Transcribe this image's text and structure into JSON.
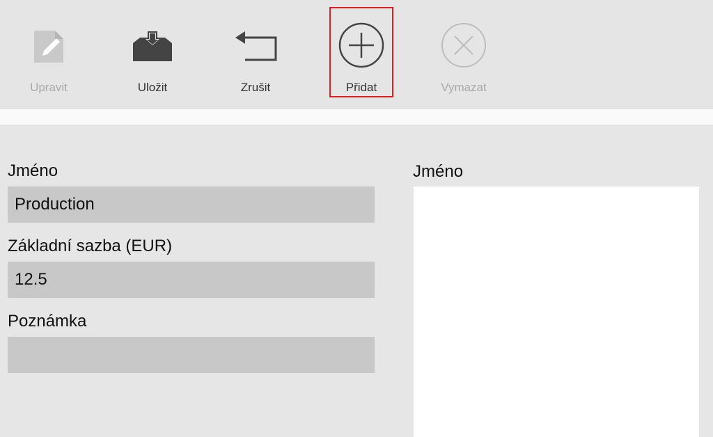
{
  "toolbar": {
    "buttons": [
      {
        "label": "Upravit",
        "icon": "edit-icon",
        "enabled": false
      },
      {
        "label": "Uložit",
        "icon": "save-icon",
        "enabled": true
      },
      {
        "label": "Zrušit",
        "icon": "undo-icon",
        "enabled": true
      },
      {
        "label": "Přidat",
        "icon": "add-icon",
        "enabled": true,
        "highlighted": true
      },
      {
        "label": "Vymazat",
        "icon": "delete-icon",
        "enabled": false
      }
    ]
  },
  "form": {
    "name_label": "Jméno",
    "name_value": "Production",
    "rate_label": "Základní sazba (EUR)",
    "rate_value": "12.5",
    "note_label": "Poznámka",
    "note_value": ""
  },
  "list": {
    "header": "Jméno"
  },
  "colors": {
    "highlight_border": "#e02020",
    "input_bg": "#c8c8c8",
    "disabled_text": "#a9a9a9"
  }
}
